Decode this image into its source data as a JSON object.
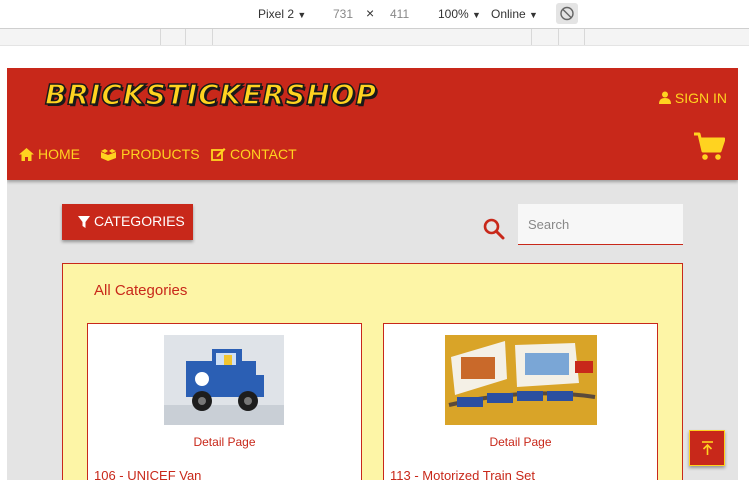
{
  "devtools": {
    "device": "Pixel 2",
    "width": "731",
    "times": "×",
    "height": "411",
    "zoom": "100%",
    "network": "Online",
    "dropdown_glyph": "▼"
  },
  "site": {
    "logo": "BRICKSTICKERSHOP",
    "sign_in": "SIGN IN",
    "nav": [
      {
        "label": "HOME",
        "icon": "home-icon"
      },
      {
        "label": "PRODUCTS",
        "icon": "boxes-icon"
      },
      {
        "label": "CONTACT",
        "icon": "edit-icon"
      }
    ],
    "categories_button": "CATEGORIES",
    "search": {
      "placeholder": "Search",
      "value": ""
    },
    "section_title": "All Categories",
    "cards": [
      {
        "detail": "Detail Page",
        "name": "106 - UNICEF Van"
      },
      {
        "detail": "Detail Page",
        "name": "113 - Motorized Train Set"
      }
    ]
  },
  "colors": {
    "brand_red": "#c8281a",
    "brand_yellow": "#ffd320",
    "panel_yellow": "#fdf5a6",
    "page_grey": "#e4e4e4"
  }
}
